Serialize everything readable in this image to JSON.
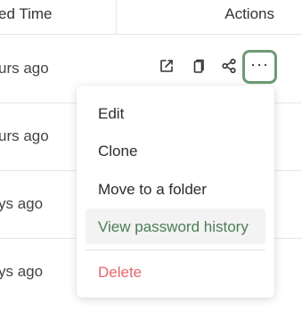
{
  "table": {
    "columns": [
      "ed Time",
      "Actions"
    ],
    "rows": [
      {
        "time": "urs ago"
      },
      {
        "time": "urs ago"
      },
      {
        "time": "ys ago"
      },
      {
        "time": "ys ago"
      }
    ]
  },
  "actions": {
    "more_label": "···"
  },
  "menu": {
    "items": [
      "Edit",
      "Clone",
      "Move to a folder",
      "View password history",
      "Delete"
    ],
    "highlighted_item": "View password history",
    "danger_item": "Delete"
  },
  "colors": {
    "focus_ring": "#6f9a75",
    "highlight_text": "#4f7d57",
    "danger_text": "#e5676b",
    "highlight_bg": "#f2f3f2"
  }
}
